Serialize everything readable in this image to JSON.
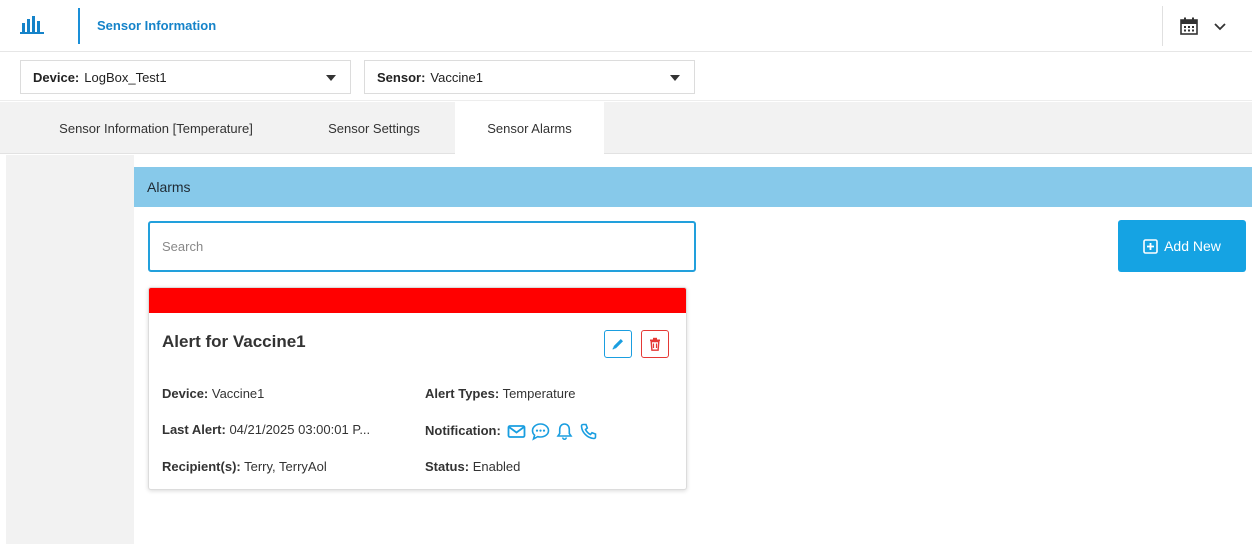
{
  "header": {
    "app_title": "Sensor Information",
    "logo_icon": "bar-chart-icon",
    "calendar_icon": "calendar-icon",
    "dropdown_icon": "chevron-down-icon"
  },
  "selectors": {
    "device": {
      "label": "Device:",
      "value": "LogBox_Test1"
    },
    "sensor": {
      "label": "Sensor:",
      "value": "Vaccine1"
    }
  },
  "tabs": [
    {
      "label": "Sensor Information [Temperature]",
      "active": false
    },
    {
      "label": "Sensor Settings",
      "active": false
    },
    {
      "label": "Sensor Alarms",
      "active": true
    }
  ],
  "alarms_panel": {
    "title": "Alarms",
    "search": {
      "placeholder": "Search",
      "value": ""
    },
    "add_button": "Add New"
  },
  "alarm_card": {
    "title": "Alert for Vaccine1",
    "status_color": "#ff0000",
    "device_label": "Device:",
    "device_value": "Vaccine1",
    "alert_types_label": "Alert Types:",
    "alert_types_value": "Temperature",
    "last_alert_label": "Last Alert:",
    "last_alert_value": "04/21/2025 03:00:01 P...",
    "notification_label": "Notification:",
    "notification_icons": [
      "email-icon",
      "chat-icon",
      "bell-icon",
      "phone-icon"
    ],
    "recipients_label": "Recipient(s):",
    "recipients_value": "Terry, TerryAol",
    "status_label": "Status:",
    "status_value": "Enabled"
  },
  "colors": {
    "accent": "#15a3e3",
    "panel_header": "#87c9ea",
    "danger": "#e53935"
  }
}
